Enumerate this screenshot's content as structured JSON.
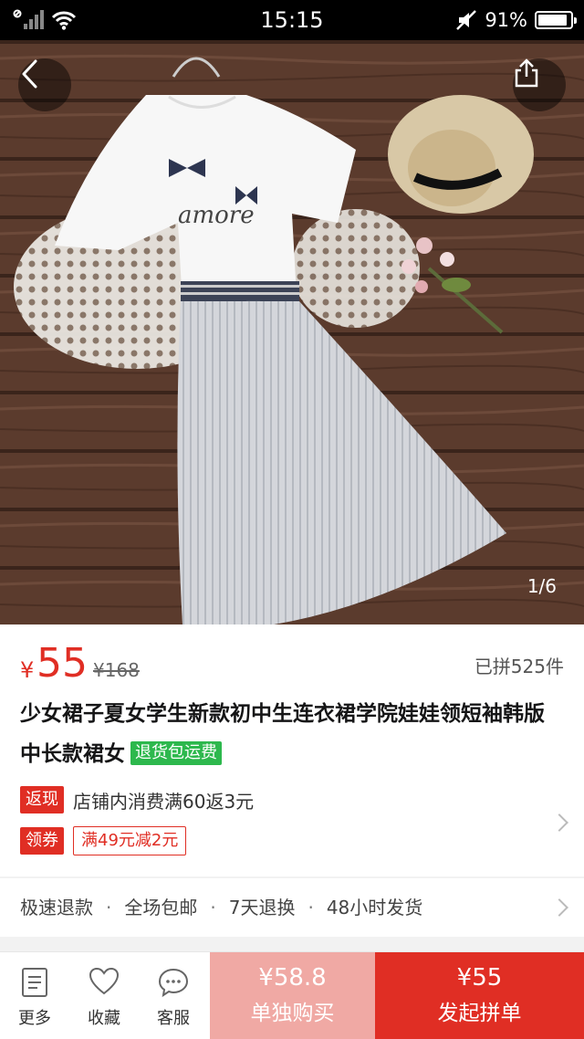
{
  "status_bar": {
    "time": "15:15",
    "battery_percent": "91%",
    "battery_level": 0.91
  },
  "gallery": {
    "page_indicator": "1/6",
    "back_icon": "chevron-left-icon",
    "share_icon": "share-icon"
  },
  "product": {
    "currency": "¥",
    "price": "55",
    "original_price": "¥168",
    "sold_count": "已拼525件",
    "title": "少女裙子夏女学生新款初中生连衣裙学院娃娃领短袖韩版中长款裙女",
    "tag": "退货包运费"
  },
  "promotions": {
    "cashback_badge": "返现",
    "cashback_text": "店铺内消费满60返3元",
    "coupon_badge": "领券",
    "coupon_text": "满49元减2元"
  },
  "services": {
    "items": [
      "极速退款",
      "全场包邮",
      "7天退换",
      "48小时发货"
    ],
    "separator": "·"
  },
  "bottom_bar": {
    "more_label": "更多",
    "favorite_label": "收藏",
    "service_label": "客服",
    "single_price": "¥58.8",
    "single_label": "单独购买",
    "group_price": "¥55",
    "group_label": "发起拼单"
  },
  "colors": {
    "accent": "#e02e24",
    "single_button": "#f0a9a4",
    "tag_green": "#2db84d"
  }
}
